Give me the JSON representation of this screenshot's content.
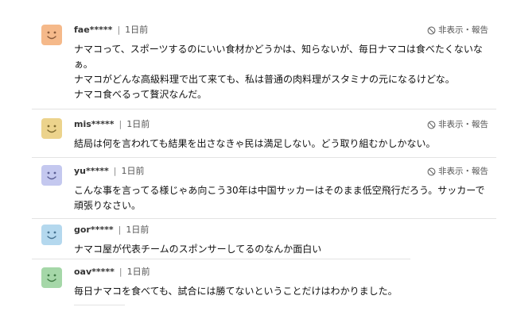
{
  "report_label": "非表示・報告",
  "separator": "|",
  "colors": {
    "avatar_orange": "#f5b98a",
    "avatar_yellow": "#ecd38c",
    "avatar_lavender": "#c4c8ef",
    "avatar_blue": "#b4d8ee",
    "avatar_green": "#a5d7a8"
  },
  "comments": [
    {
      "user": "fae*****",
      "time": "1日前",
      "lines": [
        "ナマコって、スポーツするのにいい食材かどうかは、知らないが、毎日ナマコは食べたくないな",
        "ぁ。",
        "ナマコがどんな高級料理で出て来ても、私は普通の肉料理がスタミナの元になるけどな。",
        "ナマコ食べるって贅沢なんだ。"
      ]
    },
    {
      "user": "mis*****",
      "time": "1日前",
      "lines": [
        "結局は何を言われても結果を出さなきゃ民は満足しない。どう取り組むかしかない。"
      ]
    },
    {
      "user": "yu*****",
      "time": "1日前",
      "lines": [
        "こんな事を言ってる様じゃあ向こう30年は中国サッカーはそのまま低空飛行だろう。サッカーで",
        "頑張りなさい。"
      ]
    },
    {
      "user": "gor*****",
      "time": "1日前",
      "lines": [
        "ナマコ屋が代表チームのスポンサーしてるのなんか面白い"
      ]
    },
    {
      "user": "oav*****",
      "time": "1日前",
      "lines": [
        "毎日ナマコを食べても、試合には勝てないということだけはわかりました。"
      ]
    }
  ]
}
